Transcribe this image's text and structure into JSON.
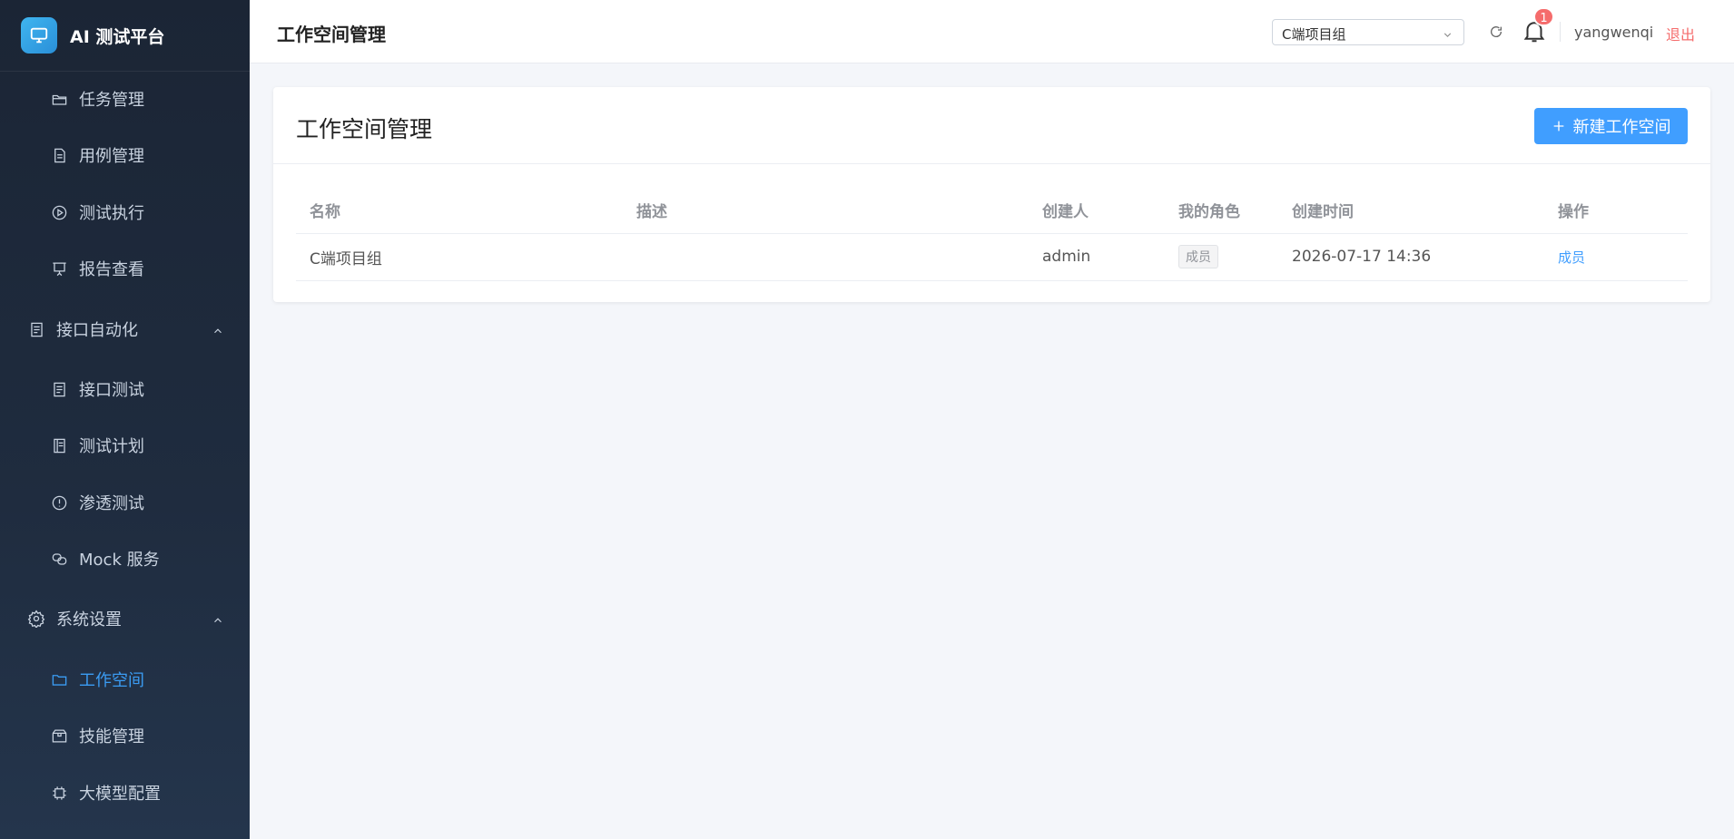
{
  "app": {
    "title": "AI 测试平台"
  },
  "sidebar": {
    "items": [
      {
        "label": "任务管理",
        "icon": "folder-open-icon"
      },
      {
        "label": "用例管理",
        "icon": "document-icon"
      },
      {
        "label": "测试执行",
        "icon": "play-circle-icon"
      },
      {
        "label": "报告查看",
        "icon": "presentation-icon"
      },
      {
        "label": "接口自动化",
        "icon": "document-list-icon",
        "group": true,
        "expanded": true
      },
      {
        "label": "接口测试",
        "icon": "document-list-icon"
      },
      {
        "label": "测试计划",
        "icon": "notebook-icon"
      },
      {
        "label": "渗透测试",
        "icon": "warning-circle-icon"
      },
      {
        "label": "Mock 服务",
        "icon": "connection-icon"
      },
      {
        "label": "系统设置",
        "icon": "gear-icon",
        "group": true,
        "expanded": true
      },
      {
        "label": "工作空间",
        "icon": "folder-icon",
        "active": true
      },
      {
        "label": "技能管理",
        "icon": "box-icon"
      },
      {
        "label": "大模型配置",
        "icon": "cpu-icon"
      }
    ]
  },
  "header": {
    "title": "工作空间管理",
    "workspace_select": "C端项目组",
    "notification_count": "1",
    "username": "yangwenqi",
    "logout": "退出"
  },
  "main": {
    "card_title": "工作空间管理",
    "new_button": "新建工作空间",
    "table": {
      "headers": [
        "名称",
        "描述",
        "创建人",
        "我的角色",
        "创建时间",
        "操作"
      ],
      "rows": [
        {
          "name": "C端项目组",
          "desc": "",
          "creator": "admin",
          "role": "成员",
          "created": "2026-07-17 14:36",
          "action": "成员"
        }
      ]
    }
  },
  "colors": {
    "accent": "#409eff",
    "danger": "#f56c6c",
    "sidebar_bg": "#1f2c3f",
    "active_menu": "#3b9cf3"
  }
}
